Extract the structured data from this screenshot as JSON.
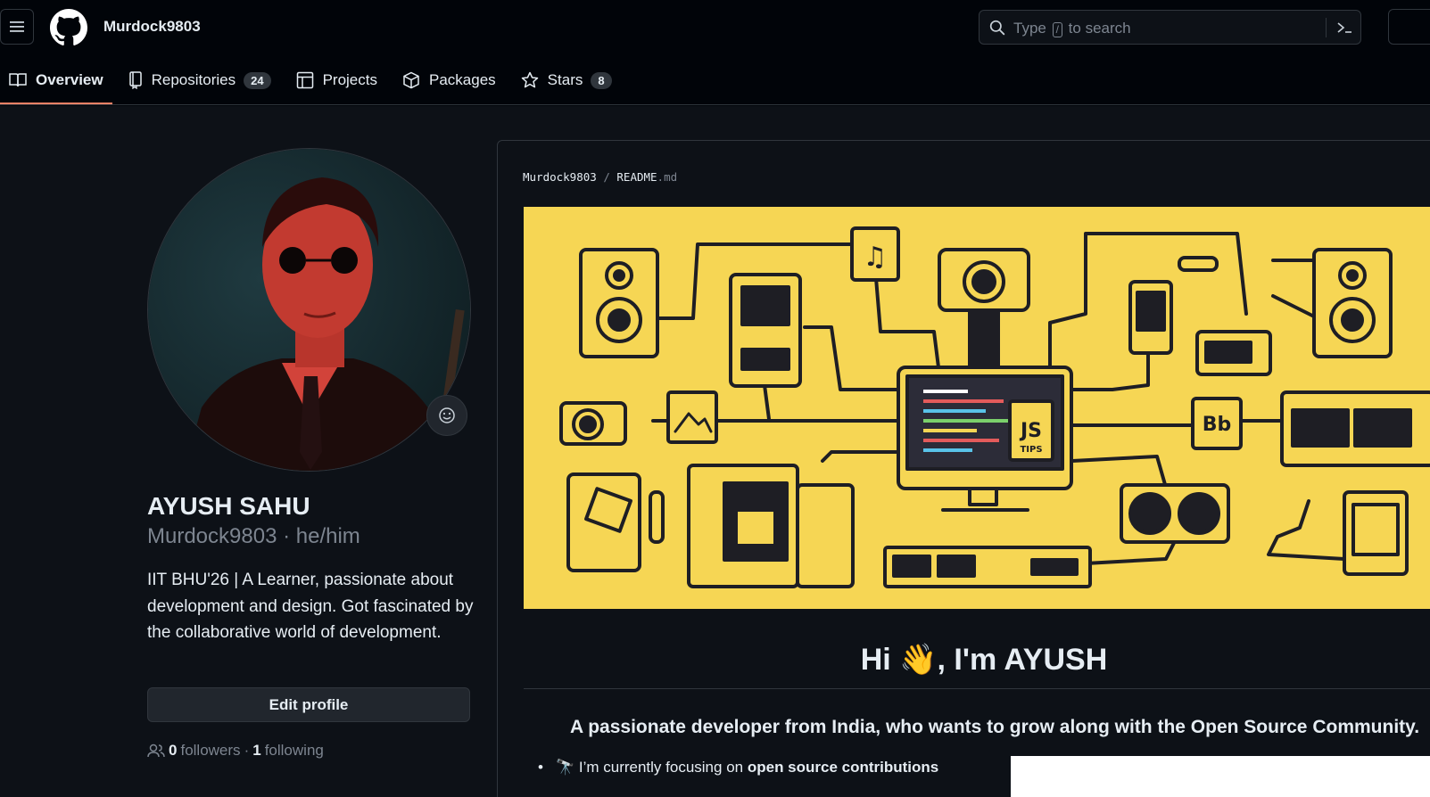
{
  "header": {
    "username": "Murdock9803",
    "search": {
      "prefix": "Type",
      "key": "/",
      "suffix": "to search"
    }
  },
  "tabs": [
    {
      "label": "Overview",
      "icon": "book-icon",
      "count": null
    },
    {
      "label": "Repositories",
      "icon": "repo-icon",
      "count": "24"
    },
    {
      "label": "Projects",
      "icon": "table-icon",
      "count": null
    },
    {
      "label": "Packages",
      "icon": "package-icon",
      "count": null
    },
    {
      "label": "Stars",
      "icon": "star-icon",
      "count": "8"
    }
  ],
  "profile": {
    "name": "AYUSH SAHU",
    "login": "Murdock9803",
    "pronouns": "he/him",
    "separator": "·",
    "bio": "IIT BHU'26 | A Learner, passionate about development and design. Got fascinated by the collaborative world of development.",
    "edit_label": "Edit profile",
    "followers_count": "0",
    "followers_label": "followers",
    "following_count": "1",
    "following_label": "following",
    "dot": "·"
  },
  "readme": {
    "owner": "Murdock9803",
    "slash": "/",
    "file_name": "README",
    "file_ext": ".md",
    "greeting_pre": "Hi",
    "greeting_emoji": "👋",
    "greeting_post": ", I'm AYUSH",
    "tagline": "A passionate developer from India, who wants to grow along with the Open Source Community.",
    "bullet_emoji": "🔭",
    "bullet_text": "I’m currently focusing on",
    "bullet_bold": "open source contributions",
    "banner_js": "JS",
    "banner_tips": "TIPS",
    "banner_bb": "Bb"
  },
  "colors": {
    "accent": "#f78166",
    "banner_bg": "#f6d654",
    "page_bg": "#0d1117"
  }
}
